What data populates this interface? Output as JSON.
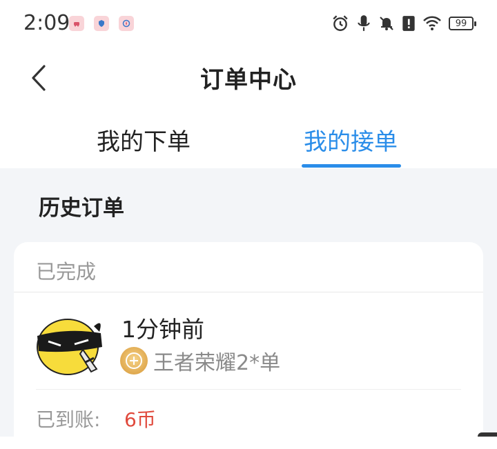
{
  "status_bar": {
    "time": "2:09",
    "battery": "99",
    "notification_icons": [
      "car-app-icon",
      "shield-app-icon",
      "compass-app-icon"
    ],
    "system_icons": [
      "alarm-icon",
      "microphone-icon",
      "bell-off-icon",
      "alert-icon",
      "wifi-icon",
      "battery-icon"
    ]
  },
  "header": {
    "title": "订单中心"
  },
  "tabs": [
    {
      "label": "我的下单",
      "active": false
    },
    {
      "label": "我的接单",
      "active": true
    }
  ],
  "section": {
    "title": "历史订单"
  },
  "order": {
    "status": "已完成",
    "time": "1分钟前",
    "game": "王者荣耀2*单",
    "paid_label": "已到账:",
    "paid_value": "6币"
  },
  "colors": {
    "accent": "#2a8de9",
    "price": "#e0493c",
    "background": "#f3f5f8"
  }
}
